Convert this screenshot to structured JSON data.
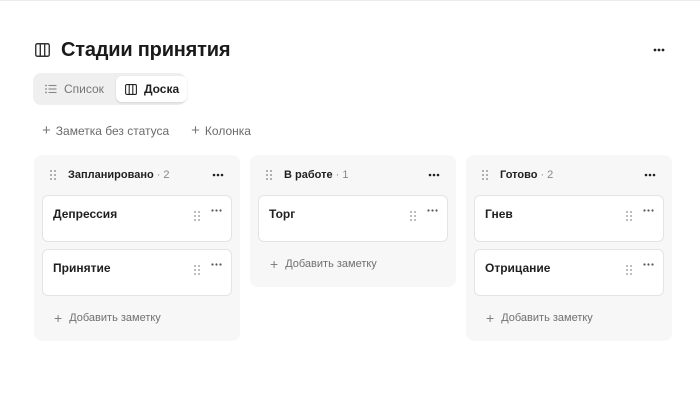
{
  "page": {
    "title": "Стадии принятия",
    "icons": {
      "title": "board-columns-icon",
      "more": "more-horizontal-icon"
    }
  },
  "views": [
    {
      "label": "Список",
      "icon": "list-icon",
      "active": false
    },
    {
      "label": "Доска",
      "icon": "board-icon",
      "active": true
    }
  ],
  "actions": {
    "add_no_status": "Заметка без статуса",
    "add_column": "Колонка"
  },
  "columns": [
    {
      "title": "Запланировано",
      "count": "· 2",
      "cards": [
        {
          "title": "Депрессия"
        },
        {
          "title": "Принятие"
        }
      ],
      "add_label": "Добавить заметку"
    },
    {
      "title": "В работе",
      "count": "· 1",
      "cards": [
        {
          "title": "Торг"
        }
      ],
      "add_label": "Добавить заметку"
    },
    {
      "title": "Готово",
      "count": "· 2",
      "cards": [
        {
          "title": "Гнев"
        },
        {
          "title": "Отрицание"
        }
      ],
      "add_label": "Добавить заметку"
    }
  ],
  "colors": {
    "column_bg": "#f7f7f7",
    "card_border": "#e4e4e4",
    "switch_bg": "#efefef"
  }
}
